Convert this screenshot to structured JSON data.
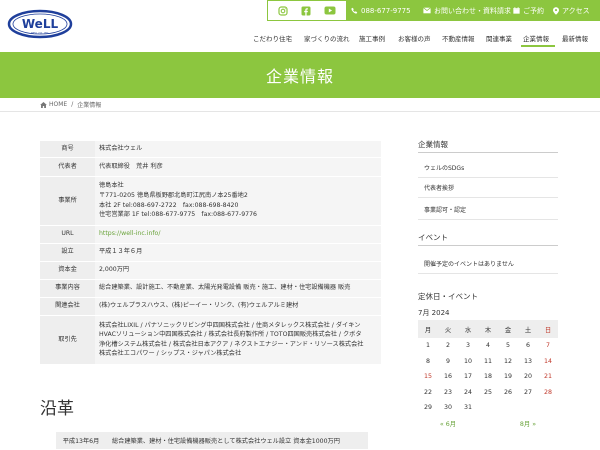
{
  "header": {
    "logo_text": "WeLL",
    "logo_sub": "WELL CO.,LTD.",
    "phone": "088-677-9775",
    "contact": "お問い合わせ・資料請求",
    "reserve": "ご予約",
    "access": "アクセス",
    "nav": [
      "こだわり住宅",
      "家づくりの流れ",
      "施工事例",
      "お客様の声",
      "不動産情報",
      "関連事業",
      "企業情報",
      "最新情報"
    ]
  },
  "hero": {
    "title": "企業情報"
  },
  "breadcrumb": {
    "home": "HOME",
    "current": "企業情報"
  },
  "company": {
    "rows": [
      {
        "key": "商号",
        "value": "株式会社ウェル"
      },
      {
        "key": "代表者",
        "value": "代表取締役　荒井 利彦"
      },
      {
        "key": "事業所",
        "lines": [
          "徳島本社",
          "〒771-0205 徳島県板野郡北島町江尻南ノ本25番地2",
          "本社 2F tel:088-697-2722　fax:088-698-8420",
          "住宅営業部 1F tel:088-677-9775　fax:088-677-9776"
        ]
      },
      {
        "key": "URL",
        "value": "https://well-inc.info/"
      },
      {
        "key": "設立",
        "value": "平成１３年６月"
      },
      {
        "key": "資本金",
        "value": "2,000万円"
      },
      {
        "key": "事業内容",
        "value": "総合建築業、設計施工、不動産業、太陽光発電設備 販売・施工、建材・住宅設備機器 販売"
      },
      {
        "key": "関連会社",
        "value": "(株)ウェルプラスハウス、(株)ピーイー・リンク、(有)ウェルアルミ建材"
      },
      {
        "key": "取引先",
        "lines": [
          "株式会社LIXIL / パナソニックリビング中四国株式会社 / 住商メタレックス株式会社 / ダイキン",
          "HVACソリューション中四国株式会社 / 株式会社長府製作所 / TOTO四国販売株式会社 / クボタ",
          "浄化槽システム株式会社 / 株式会社日本アクア / ネクストエナジー・アンド・リソース株式会社",
          "株式会社エコパワー / シップス・ジャパン株式会社"
        ]
      }
    ]
  },
  "history": {
    "title": "沿革",
    "rows": [
      {
        "date": "平成13年6月",
        "text": "総合建築業、建材・住宅設備機器販売として株式会社ウェル設立 資本金1000万円"
      }
    ]
  },
  "sidebar": {
    "company_title": "企業情報",
    "links": [
      "ウェルのSDGs",
      "代表者挨拶",
      "事業認可・認定"
    ],
    "event_title": "イベント",
    "event_text": "開催予定のイベントはありません",
    "calendar_title": "定休日・イベント",
    "month": "7月 2024",
    "weekdays": [
      "月",
      "火",
      "水",
      "木",
      "金",
      "土",
      "日"
    ],
    "weeks": [
      [
        "1",
        "2",
        "3",
        "4",
        "5",
        "6",
        "7"
      ],
      [
        "8",
        "9",
        "10",
        "11",
        "12",
        "13",
        "14"
      ],
      [
        "15",
        "16",
        "17",
        "18",
        "19",
        "20",
        "21"
      ],
      [
        "22",
        "23",
        "24",
        "25",
        "26",
        "27",
        "28"
      ],
      [
        "29",
        "30",
        "31",
        "",
        "",
        "",
        ""
      ]
    ],
    "prev": "« 6月",
    "next": "8月 »"
  },
  "colors": {
    "accent": "#8cc63f",
    "link": "#6aa33b",
    "holiday": "#c0392b"
  }
}
